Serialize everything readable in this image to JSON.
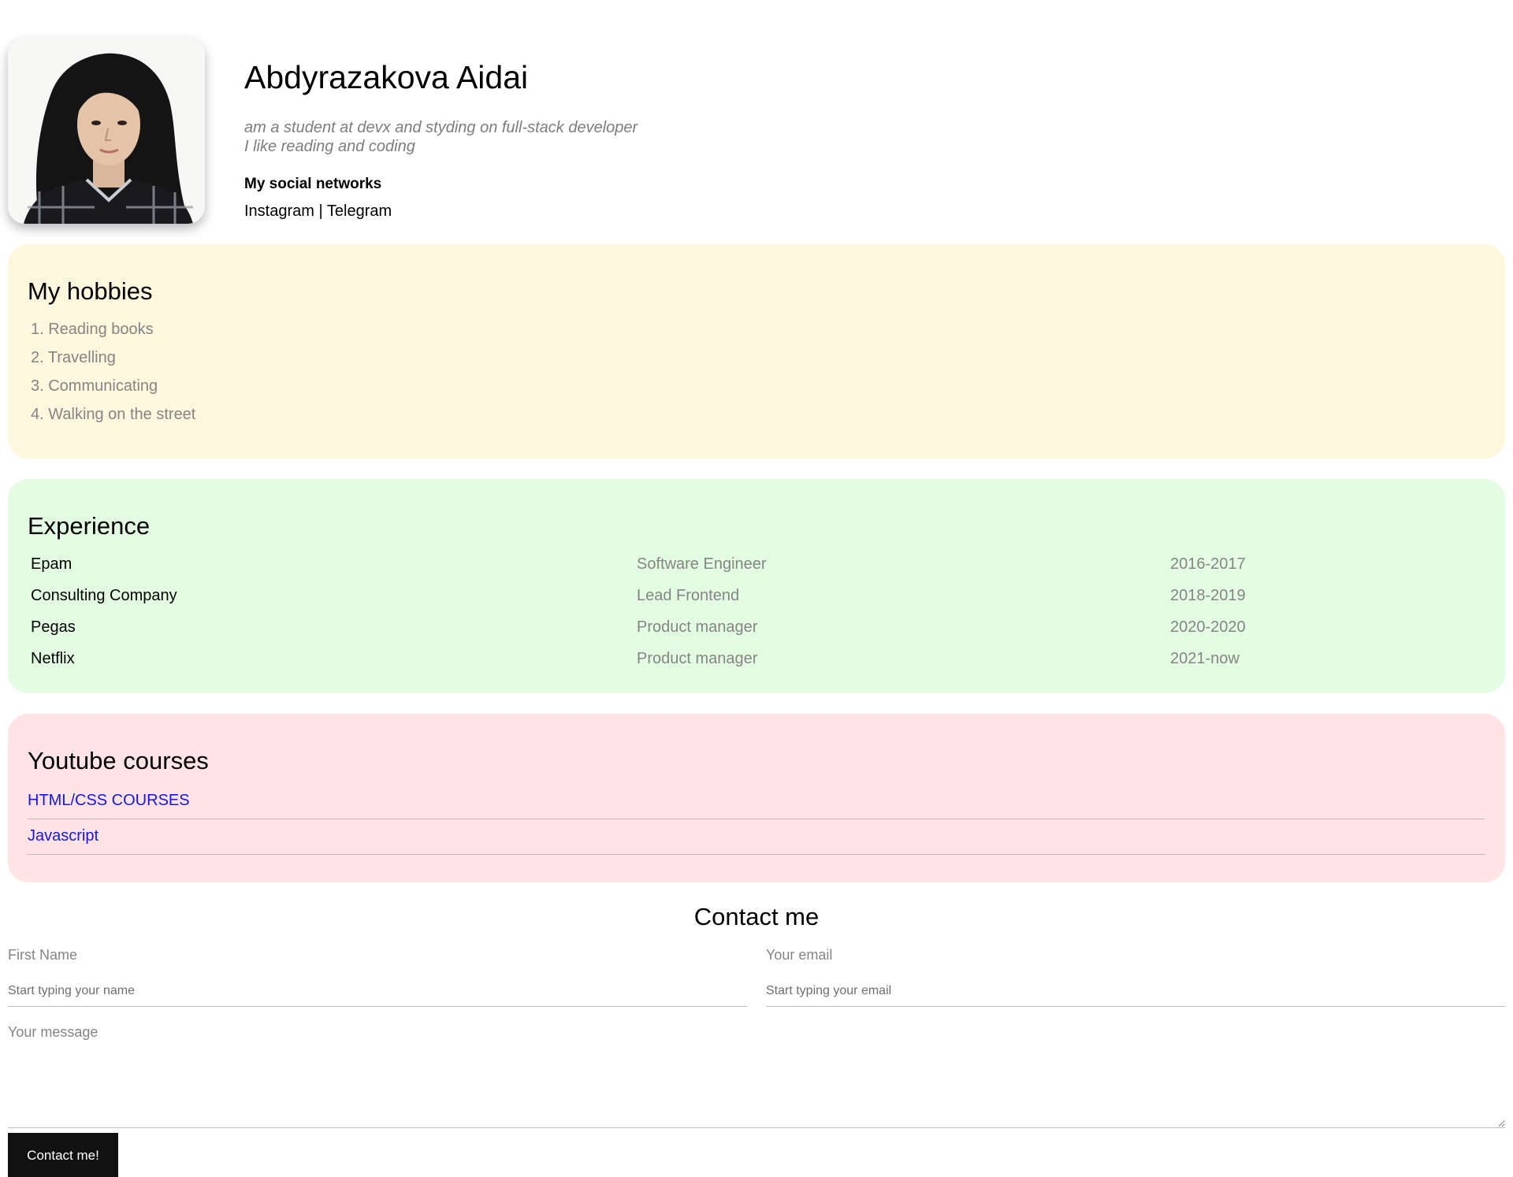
{
  "profile": {
    "name": "Abdyrazakova Aidai",
    "bio_line1": "am a student at devx and styding on full-stack developer",
    "bio_line2": "I like reading and coding",
    "social_title": "My social networks",
    "social_links": [
      "Instagram",
      "Telegram"
    ],
    "social_separator": " | "
  },
  "hobbies": {
    "title": "My hobbies",
    "items": [
      "1. Reading books",
      "2. Travelling",
      "3. Communicating",
      "4. Walking on the street"
    ]
  },
  "experience": {
    "title": "Experience",
    "rows": [
      {
        "company": "Epam",
        "role": "Software Engineer",
        "years": "2016-2017"
      },
      {
        "company": "Consulting Company",
        "role": "Lead Frontend",
        "years": "2018-2019"
      },
      {
        "company": "Pegas",
        "role": "Product manager",
        "years": "2020-2020"
      },
      {
        "company": "Netflix",
        "role": "Product manager",
        "years": "2021-now"
      }
    ]
  },
  "courses": {
    "title": "Youtube courses",
    "items": [
      "HTML/CSS COURSES",
      "Javascript"
    ]
  },
  "contact": {
    "title": "Contact me",
    "first_name_label": "First Name",
    "first_name_placeholder": "Start typing your name",
    "email_label": "Your email",
    "email_placeholder": "Start typing your email",
    "message_label": "Your message",
    "submit_label": "Contact me!"
  },
  "colors": {
    "hobbies_bg": "#fdf7dd",
    "experience_bg": "#e3fde3",
    "courses_bg": "#ffe3e5",
    "link": "#1616e6",
    "button_bg": "#111111"
  }
}
